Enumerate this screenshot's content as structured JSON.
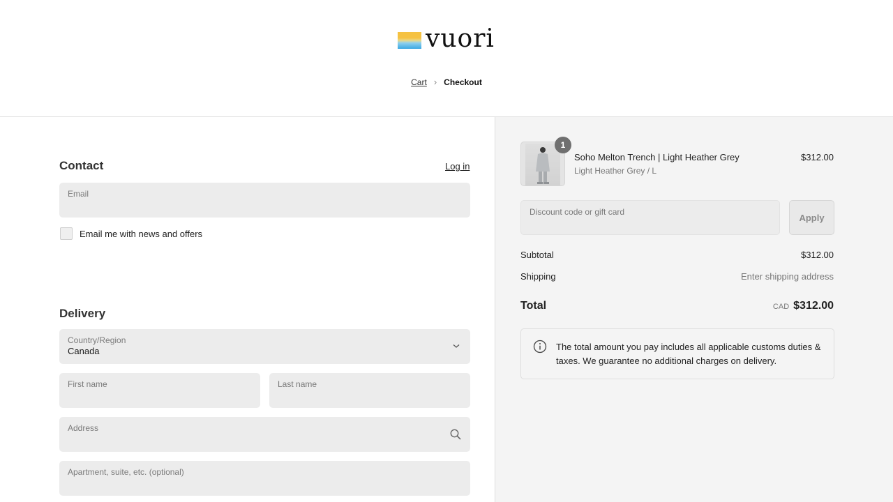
{
  "brand": {
    "name": "vuori",
    "colors": {
      "gold": "#f5c242",
      "blue": "#3aa9e2"
    }
  },
  "breadcrumb": {
    "cart": "Cart",
    "current": "Checkout"
  },
  "contact": {
    "title": "Contact",
    "login_label": "Log in",
    "email_label": "Email",
    "newsletter_label": "Email me with news and offers",
    "newsletter_checked": false
  },
  "delivery": {
    "title": "Delivery",
    "country_label": "Country/Region",
    "country_value": "Canada",
    "first_name_label": "First name",
    "last_name_label": "Last name",
    "address_label": "Address",
    "apartment_label": "Apartment, suite, etc. (optional)"
  },
  "order": {
    "item": {
      "name": "Soho Melton Trench | Light Heather Grey",
      "variant": "Light Heather Grey / L",
      "price": "$312.00",
      "quantity": "1"
    },
    "discount_placeholder": "Discount code or gift card",
    "apply_label": "Apply",
    "subtotal_label": "Subtotal",
    "subtotal_value": "$312.00",
    "shipping_label": "Shipping",
    "shipping_value": "Enter shipping address",
    "total_label": "Total",
    "currency": "CAD",
    "total_value": "$312.00",
    "notice": "The total amount you pay includes all applicable customs duties & taxes. We guarantee no additional charges on delivery."
  }
}
